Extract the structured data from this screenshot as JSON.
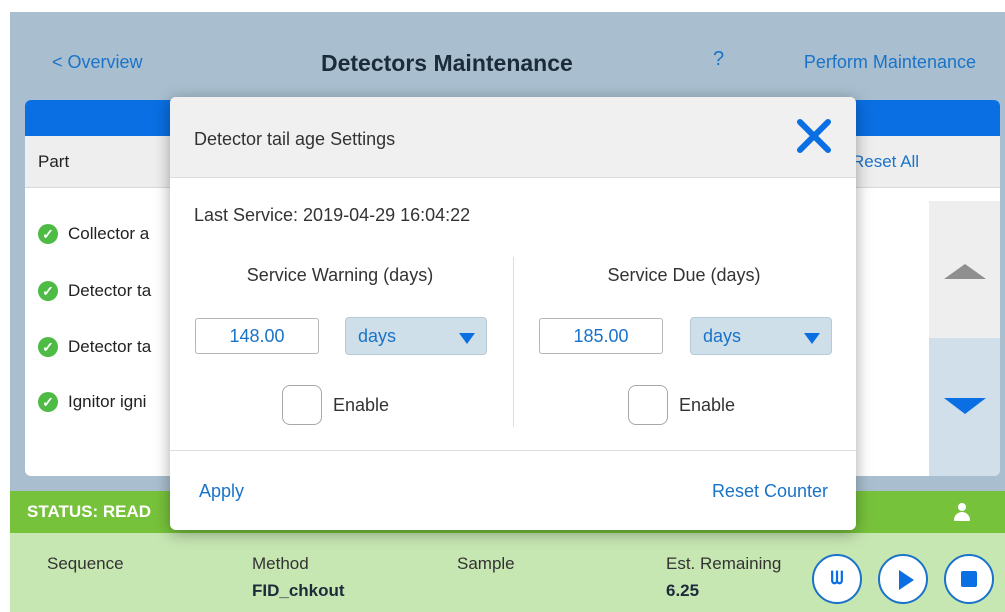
{
  "header": {
    "back_label": "< Overview",
    "title": "Detectors Maintenance",
    "help_label": "?",
    "perform_label": "Perform Maintenance"
  },
  "table": {
    "col_part": "Part",
    "reset_all_label": "Reset All",
    "rows": [
      {
        "label": "Collector a",
        "status": "ok"
      },
      {
        "label": "Detector ta",
        "status": "ok"
      },
      {
        "label": "Detector ta",
        "status": "ok"
      },
      {
        "label": "Ignitor igni",
        "status": "ok"
      }
    ]
  },
  "status": {
    "text": "STATUS: READ"
  },
  "footer": {
    "sequence_label": "Sequence",
    "method_label": "Method",
    "method_value": "FID_chkout",
    "sample_label": "Sample",
    "remaining_label": "Est. Remaining",
    "remaining_value": "6.25",
    "vial_glyph": "ᗯ"
  },
  "dialog": {
    "title": "Detector tail age Settings",
    "last_service": "Last Service:  2019-04-29 16:04:22",
    "warning": {
      "title": "Service Warning (days)",
      "value": "148.00",
      "unit": "days",
      "enable_label": "Enable",
      "enabled": false
    },
    "due": {
      "title": "Service Due (days)",
      "value": "185.00",
      "unit": "days",
      "enable_label": "Enable",
      "enabled": false
    },
    "apply_label": "Apply",
    "reset_counter_label": "Reset Counter"
  },
  "colors": {
    "accent": "#0a6fe2",
    "link": "#1a73c9",
    "status_green": "#77c23b",
    "footer_green": "#c6e6b2",
    "header_bg": "#a9bfcf"
  },
  "icons": [
    "check-circle-icon",
    "close-icon",
    "triangle-up-icon",
    "triangle-down-icon",
    "user-icon",
    "vial-icon",
    "play-icon",
    "stop-icon",
    "chevron-down-icon"
  ]
}
